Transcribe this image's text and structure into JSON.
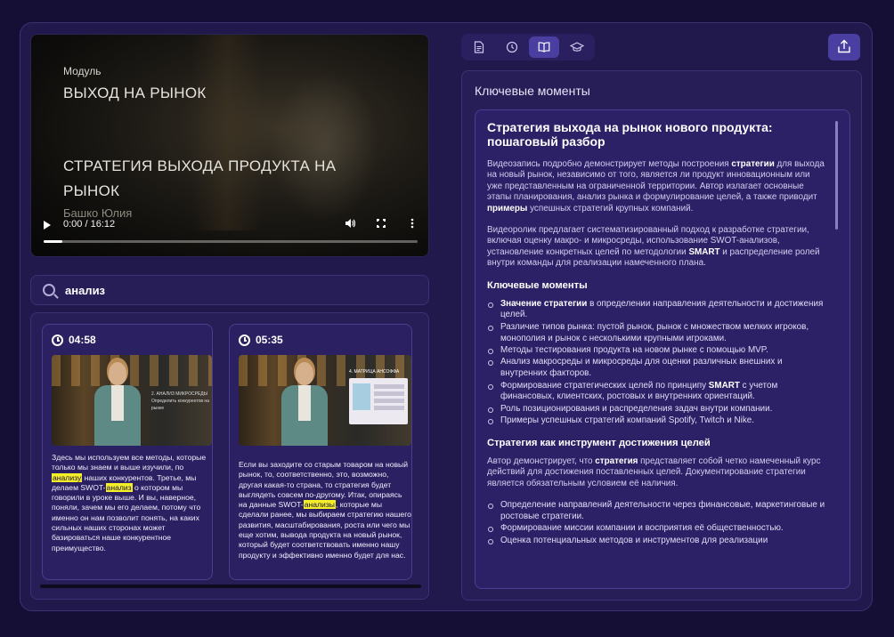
{
  "video": {
    "module_label": "Модуль",
    "title_line1": "ВЫХОД НА РЫНОК",
    "title_line2": "СТРАТЕГИЯ ВЫХОДА ПРОДУКТА НА РЫНОК",
    "author": "Башко Юлия",
    "time": "0:00 / 16:12",
    "progress": 0.05
  },
  "search": {
    "value": "анализ",
    "placeholder": ""
  },
  "results": [
    {
      "time": "04:58",
      "thumb_caption": "2. АНАЛИЗ МИКРОСРЕДЫ",
      "thumb_subcaption": "Определить конкурентов на рынке",
      "text_before": "Здесь мы используем все методы, которые только мы знаем и выше изучили, по ",
      "hl1": "анализу",
      "text_mid": " наших конкурентов. Третье, мы делаем SWOT-",
      "hl2": "анализ",
      "text_after": " о котором мы говорили в уроке выше. И вы, наверное, поняли, зачем мы его делаем, потому что именно он нам позволит понять, на каких сильных наших сторонах может базироваться наше конкурентное преимущество."
    },
    {
      "time": "05:35",
      "thumb_caption": "4. МАТРИЦА АНСОФФА",
      "text_before": "Если вы заходите со старым товаром на новый рынок, то, соответственно, это, возможно, другая какая-то страна, то стратегия будет выглядеть совсем по-другому. Итак, опираясь на данные SWOT-",
      "hl1": "анализы",
      "text_after": ", которые мы сделали ранее, мы выбираем стратегию нашего развития, масштабирования, роста или чего мы еще хотим, вывода продукта на новый рынок, который будет соответствовать именно нашу продукту и эффективно именно будет для нас."
    }
  ],
  "tabs": [
    {
      "icon": "document-icon",
      "active": false
    },
    {
      "icon": "history-icon",
      "active": false
    },
    {
      "icon": "book-icon",
      "active": true
    },
    {
      "icon": "graduation-cap-icon",
      "active": false
    }
  ],
  "panel": {
    "title": "Ключевые моменты",
    "content": {
      "heading": "Стратегия выхода на рынок нового продукта: пошаговый разбор",
      "p1_a": "Видеозапись подробно демонстрирует методы построения ",
      "p1_b1": "стратегии",
      "p1_c": " для выхода на новый рынок, независимо от того, является ли продукт инновационным или уже представленным на ограниченной территории. Автор излагает основные этапы планирования, анализ рынка и формулирование целей, а также приводит ",
      "p1_b2": "примеры",
      "p1_d": " успешных стратегий крупных компаний.",
      "p2_a": "Видеоролик предлагает систематизированный подход к разработке стратегии, включая оценку макро- и микросреды, использование SWOT-анализов, установление конкретных целей по методологии ",
      "p2_b": "SMART",
      "p2_c": " и распределение ролей внутри команды для реализации намеченного плана.",
      "section1": "Ключевые моменты",
      "s1_item1_b": "Значение стратегии",
      "s1_item1_rest": " в определении направления деятельности и достижения целей.",
      "s1_item2": "Различие типов рынка: пустой рынок, рынок с множеством мелких игроков, монополия и рынок с несколькими крупными игроками.",
      "s1_item3": "Методы тестирования продукта на новом рынке с помощью MVP.",
      "s1_item4": "Анализ макросреды и микросреды для оценки различных внешних и внутренних факторов.",
      "s1_item5_a": "Формирование стратегических целей по принципу ",
      "s1_item5_b": "SMART",
      "s1_item5_c": " с учетом финансовых, клиентских, ростовых и внутренних ориентаций.",
      "s1_item6": "Роль позиционирования и распределения задач внутри компании.",
      "s1_item7": "Примеры успешных стратегий компаний Spotify, Twitch и Nike.",
      "section2": "Стратегия как инструмент достижения целей",
      "p3_a": "Автор демонстрирует, что ",
      "p3_b": "стратегия",
      "p3_c": " представляет собой четко намеченный курс действий для достижения поставленных целей. Документирование стратегии является обязательным условием её наличия.",
      "s2_item1": "Определение направлений деятельности через финансовые, маркетинговые и ростовые стратегии.",
      "s2_item2": "Формирование миссии компании и восприятия её общественностью.",
      "s2_item3": "Оценка потенциальных методов и инструментов для реализации"
    }
  }
}
